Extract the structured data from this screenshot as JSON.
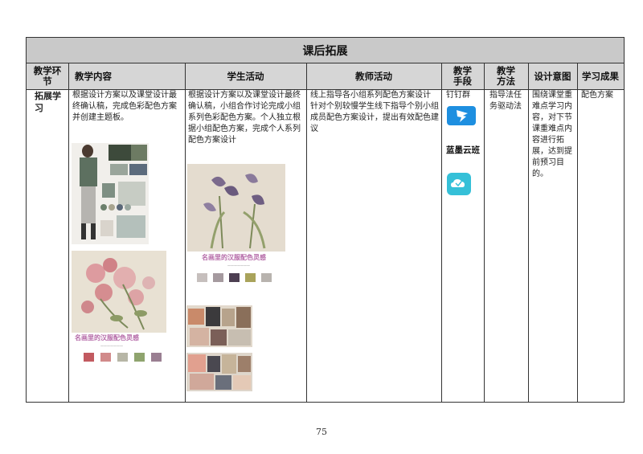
{
  "table": {
    "title": "课后拓展",
    "headers": [
      "教学环节",
      "教学内容",
      "学生活动",
      "教师活动",
      "教学手段",
      "教学方法",
      "设计意图",
      "学习成果"
    ],
    "row": {
      "stage": "拓展学习",
      "content": "根据设计方案以及课堂设计最终确认稿，完成色彩配色方案并创建主题板。",
      "student": "根据设计方案以及课堂设计最终确认稿，小组合作讨论完成小组系列色彩配色方案。个人独立根据小组配色方案，完成个人系列配色方案设计",
      "teacher_1": "线上指导各小组系列配色方案设计",
      "teacher_2": "针对个别较慢学生线下指导个别小组成员配色方案设计，提出有效配色建议",
      "tool_1": "钉钉群",
      "tool_2": "蓝墨云班",
      "method": "指导法任务驱动法",
      "intent": "围绕课堂重难点学习内容，对下节课重难点内容进行拓展，达到提前预习目的。",
      "outcome": "配色方案"
    },
    "images": {
      "caption_1": "名画里的汉服配色灵感",
      "caption_2": "名画里的汉服配色灵感"
    }
  },
  "page_number": "75",
  "colors": {
    "title_bg": "#c9c9c9",
    "header_bg": "#d6d6d6",
    "dingtalk": "#1e8fe0",
    "lanmo": "#35c0d8",
    "caption": "#b56aa8"
  },
  "palettes": {
    "flower": [
      "#c25a60",
      "#d18a8a",
      "#b7b6a6",
      "#8fa46e",
      "#9a7f92"
    ],
    "iris": [
      "#c6bfbd",
      "#a59a9f",
      "#4d3f52",
      "#a9a35b",
      "#b8b3ae"
    ]
  }
}
